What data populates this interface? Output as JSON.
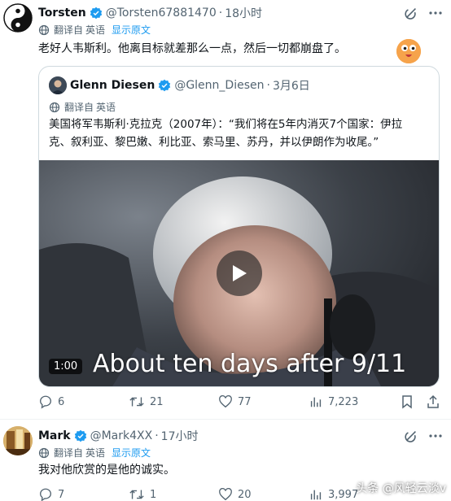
{
  "tweet1": {
    "name": "Torsten",
    "handle": "@Torsten67881470",
    "time": "18小时",
    "translated_from": "翻译自",
    "language": "英语",
    "show_original": "显示原文",
    "text": "老好人韦斯利。他离目标就差那么一点，然后一切都崩盘了。",
    "quote": {
      "name": "Glenn Diesen",
      "handle": "@Glenn_Diesen",
      "date": "3月6日",
      "translated_from": "翻译自",
      "language": "英语",
      "text_line1": "美国将军韦斯利·克拉克（2007年）：“我们将在5年内消灭7个国家：伊拉",
      "text_line2": "克、叙利亚、黎巴嫩、利比亚、索马里、苏丹，并以伊朗作为收尾。”",
      "video_duration": "1:00",
      "video_caption": "About ten days after 9/11"
    },
    "stats": {
      "replies": "6",
      "reposts": "21",
      "likes": "77",
      "views": "7,223"
    }
  },
  "tweet2": {
    "name": "Mark",
    "handle": "@Mark4XX",
    "time": "17小时",
    "translated_from": "翻译自",
    "language": "英语",
    "show_original": "显示原文",
    "text": "我对他欣赏的是他的诚实。",
    "stats": {
      "replies": "7",
      "reposts": "1",
      "likes": "20",
      "views": "3,997"
    }
  },
  "watermark": "头条 @风轻云淡v",
  "colors": {
    "accent": "#1d9bf0",
    "secondary_text": "#536471",
    "border": "#cfd9de"
  },
  "icons": [
    "yin-yang-avatar",
    "verified-badge",
    "grok-icon",
    "more-icon",
    "globe-icon",
    "reply-icon",
    "repost-icon",
    "like-icon",
    "views-icon",
    "bookmark-icon",
    "play-icon"
  ]
}
